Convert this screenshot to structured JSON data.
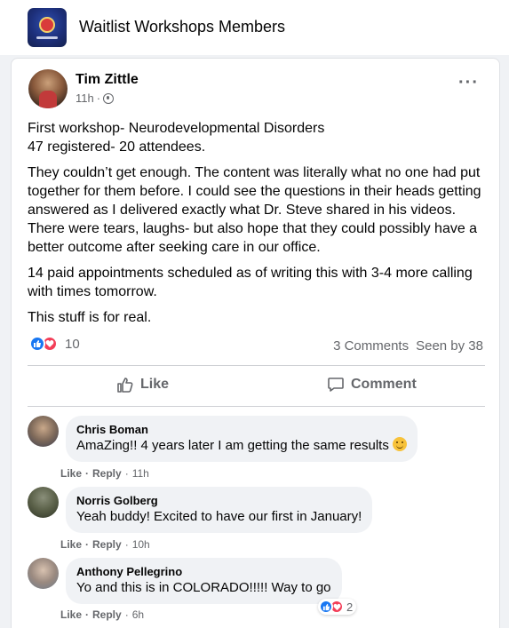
{
  "header": {
    "group_name": "Waitlist Workshops Members"
  },
  "post": {
    "author": "Tim Zittle",
    "time": "11h",
    "separator": "·",
    "paragraphs": [
      "First workshop- Neurodevelopmental Disorders\n47 registered- 20 attendees.",
      "They couldn’t get enough. The content was literally what no one had put together for them before. I could see the questions in their heads getting answered as I delivered exactly what Dr. Steve shared in his videos. There were tears, laughs- but also hope that they could possibly have a better outcome after seeking care in our office.",
      "14 paid appointments scheduled as of writing this with 3-4 more calling with times tomorrow.",
      "This stuff is for real."
    ],
    "reaction_count": "10",
    "comments_count": "3 Comments",
    "seen_by": "Seen by 38",
    "like_label": "Like",
    "comment_label": "Comment"
  },
  "comments": [
    {
      "name": "Chris Boman",
      "text": "AmaZing!! 4 years later I am getting the same results",
      "like": "Like",
      "reply": "Reply",
      "time": "11h",
      "has_emoji": true
    },
    {
      "name": "Norris Golberg",
      "text": "Yeah buddy! Excited to have our first in January!",
      "like": "Like",
      "reply": "Reply",
      "time": "10h"
    },
    {
      "name": "Anthony Pellegrino",
      "text": "Yo and this is in COLORADO!!!!! Way to go",
      "like": "Like",
      "reply": "Reply",
      "time": "6h",
      "reaction_count": "2"
    }
  ],
  "colors": {
    "accent": "#1877f2",
    "love": "#f33e58",
    "muted": "#65676b",
    "bubble": "#f0f2f5"
  },
  "icons": [
    "group-avatar-icon",
    "globe-icon",
    "more-options-icon",
    "like-reaction-icon",
    "love-reaction-icon",
    "thumbs-up-icon",
    "comment-icon",
    "smile-emoji-icon"
  ]
}
